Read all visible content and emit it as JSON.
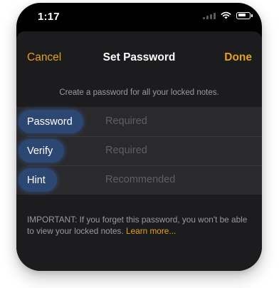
{
  "status_bar": {
    "time": "1:17",
    "icons": [
      "signal-icon",
      "wifi-icon",
      "battery-icon"
    ]
  },
  "nav": {
    "cancel_label": "Cancel",
    "title": "Set Password",
    "done_label": "Done",
    "accent_color": "#e4a11b"
  },
  "instruction": "Create a password for all your locked notes.",
  "fields": [
    {
      "label": "Password",
      "placeholder": "Required"
    },
    {
      "label": "Verify",
      "placeholder": "Required"
    },
    {
      "label": "Hint",
      "placeholder": "Recommended"
    }
  ],
  "footer": {
    "important_text": "IMPORTANT: If you forget this password, you won't be able to view your locked notes.",
    "learn_more_label": "Learn more..."
  }
}
